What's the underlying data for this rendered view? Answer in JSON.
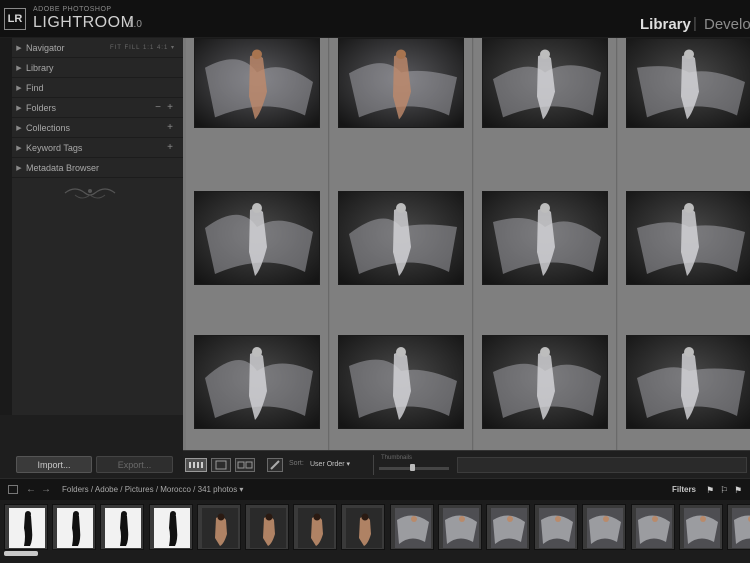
{
  "header": {
    "logo_letters": "LR",
    "brand_sub": "ADOBE PHOTOSHOP",
    "brand_main": "LIGHTROOM",
    "version": "1.0",
    "modules": [
      "Library",
      "|",
      "Develo"
    ]
  },
  "left_panel": {
    "items": [
      {
        "label": "Navigator",
        "extra": "FIT  FILL  1:1  4:1 ▾"
      },
      {
        "label": "Library",
        "extra": ""
      },
      {
        "label": "Find",
        "extra": ""
      },
      {
        "label": "Folders",
        "extra": "+"
      },
      {
        "label": "Collections",
        "extra": "+"
      },
      {
        "label": "Keyword Tags",
        "extra": "+"
      },
      {
        "label": "Metadata Browser",
        "extra": ""
      }
    ],
    "import_label": "Import...",
    "export_label": "Export..."
  },
  "toolbar": {
    "sort_label": "Sort:",
    "sort_value": "User Order ▾",
    "thumbnails_label": "Thumbnails",
    "thumbnail_size": 0.48
  },
  "filmstrip": {
    "nav_back": "←",
    "nav_forward": "→",
    "path": "Folders / Adobe / Pictures / Morocco / 341 photos ▾",
    "filters_label": "Filters",
    "thumbnail_count": 16
  },
  "grid": {
    "rows": 3,
    "columns": 4,
    "photo_count": 12
  },
  "colors": {
    "grid_background": "#797979",
    "panel_background": "#262626",
    "top_bar": "#111111",
    "accent_text": "#dedede"
  }
}
